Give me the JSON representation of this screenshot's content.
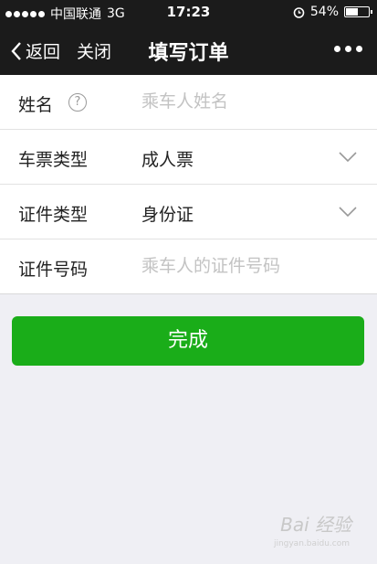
{
  "status_bar": {
    "carrier": "中国联通",
    "network": "3G",
    "time": "17:23",
    "battery": "54%",
    "battery_level": 0.54
  },
  "nav": {
    "back_label": "返回",
    "close_label": "关闭",
    "title": "填写订单"
  },
  "form": {
    "name_label": "姓名",
    "name_placeholder": "乘车人姓名",
    "ticket_type_label": "车票类型",
    "ticket_type_value": "成人票",
    "id_type_label": "证件类型",
    "id_type_value": "身份证",
    "id_number_label": "证件号码",
    "id_number_placeholder": "乘车人的证件号码"
  },
  "done_button_label": "完成",
  "watermark": {
    "text": "Bai 经验",
    "sub": "jingyan.baidu.com"
  },
  "colors": {
    "nav_bg": "#1b1b1b",
    "accent": "#1aad19",
    "page_bg": "#efeff4"
  }
}
